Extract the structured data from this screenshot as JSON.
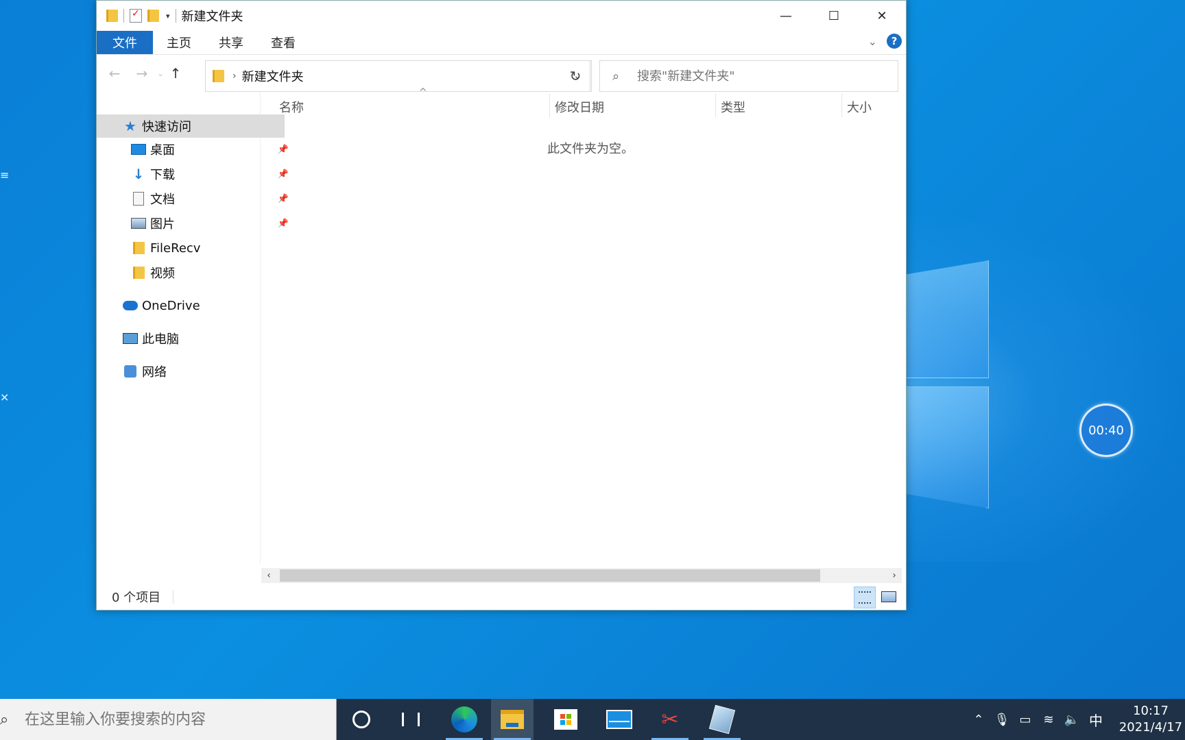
{
  "window": {
    "title": "新建文件夹",
    "qa_dropdown": "▾",
    "buttons": {
      "minimize": "—",
      "maximize": "☐",
      "close": "✕"
    }
  },
  "ribbon": {
    "tabs": [
      "文件",
      "主页",
      "共享",
      "查看"
    ],
    "expand": "⌄",
    "help": "?"
  },
  "nav": {
    "back": "←",
    "forward": "→",
    "recent": "⌄",
    "up": "↑",
    "breadcrumb_sep": "›",
    "breadcrumb": "新建文件夹",
    "address_drop": "⌄",
    "refresh": "↻",
    "search_placeholder": "搜索\"新建文件夹\""
  },
  "sidebar": {
    "quick_access": "快速访问",
    "items": [
      {
        "label": "桌面",
        "icon": "desktop-icon",
        "pinned": true
      },
      {
        "label": "下载",
        "icon": "download-icon",
        "pinned": true
      },
      {
        "label": "文档",
        "icon": "document-icon",
        "pinned": true
      },
      {
        "label": "图片",
        "icon": "picture-icon",
        "pinned": true
      },
      {
        "label": "FileRecv",
        "icon": "folder-icon",
        "pinned": false
      },
      {
        "label": "视频",
        "icon": "folder-icon",
        "pinned": false
      }
    ],
    "onedrive": "OneDrive",
    "this_pc": "此电脑",
    "network": "网络"
  },
  "content": {
    "columns": [
      "名称",
      "修改日期",
      "类型",
      "大小"
    ],
    "empty_message": "此文件夹为空。"
  },
  "status": {
    "item_count": "0 个项目"
  },
  "taskbar": {
    "search_placeholder": "在这里输入你要搜索的内容",
    "time": "10:17",
    "date": "2021/4/17",
    "ime": "中"
  },
  "desktop": {
    "timer": "00:40"
  },
  "colors": {
    "accent": "#1a6fc4",
    "taskbar": "#1e3146",
    "desktop": "#0a7fd6"
  }
}
